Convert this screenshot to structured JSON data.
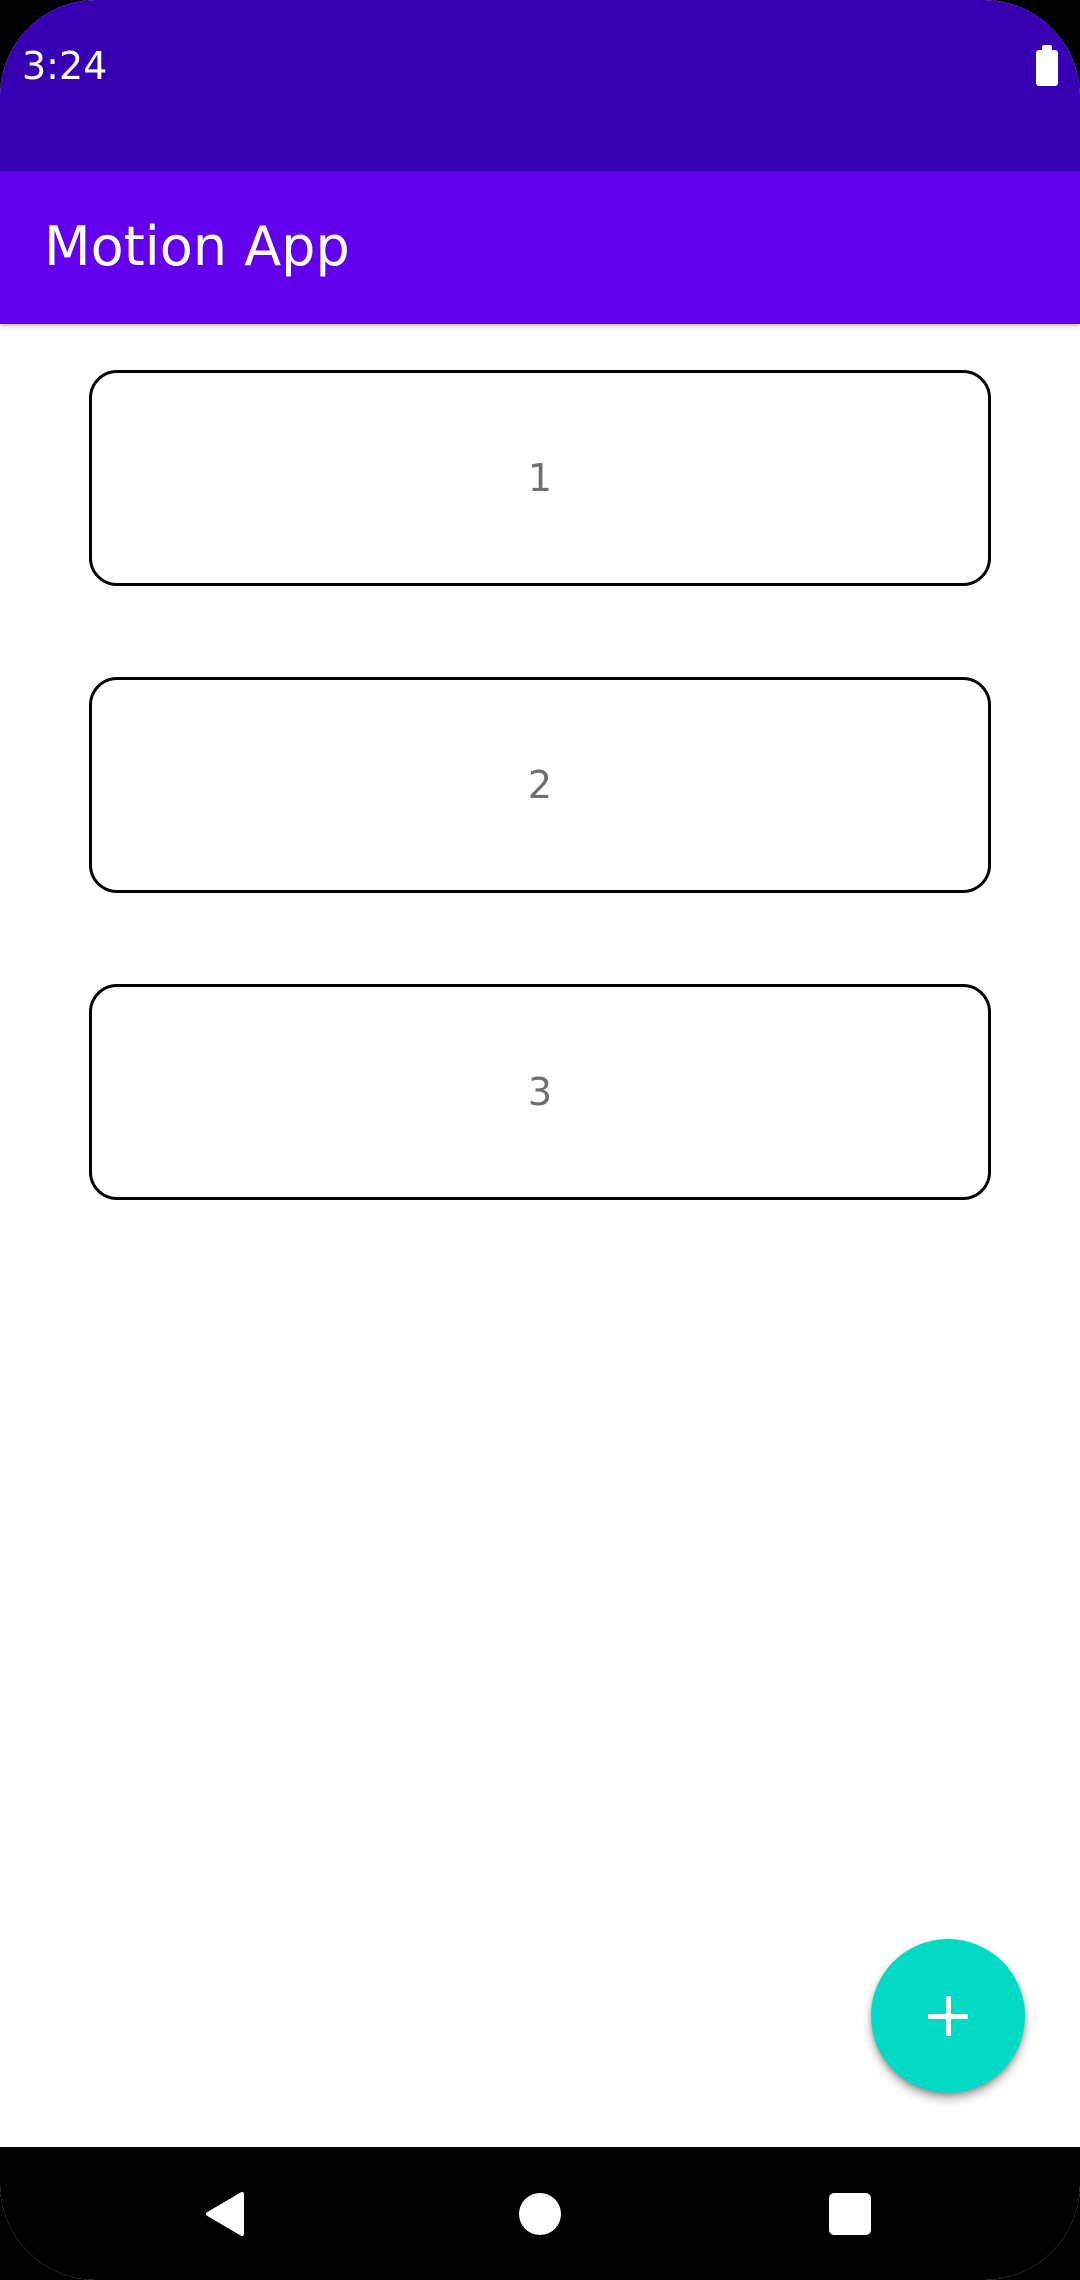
{
  "status_bar": {
    "time": "3:24",
    "battery_icon": "battery-full-icon"
  },
  "app_bar": {
    "title": "Motion App"
  },
  "cards": [
    {
      "label": "1"
    },
    {
      "label": "2"
    },
    {
      "label": "3"
    }
  ],
  "fab": {
    "icon": "plus-icon"
  },
  "nav_bar": {
    "back_icon": "back-triangle-icon",
    "home_icon": "home-circle-icon",
    "recents_icon": "recents-square-icon"
  },
  "colors": {
    "status_bar": "#3700b3",
    "app_bar": "#6200ee",
    "fab": "#03dac5",
    "card_border": "#000000",
    "card_text": "#6f6f6f"
  }
}
